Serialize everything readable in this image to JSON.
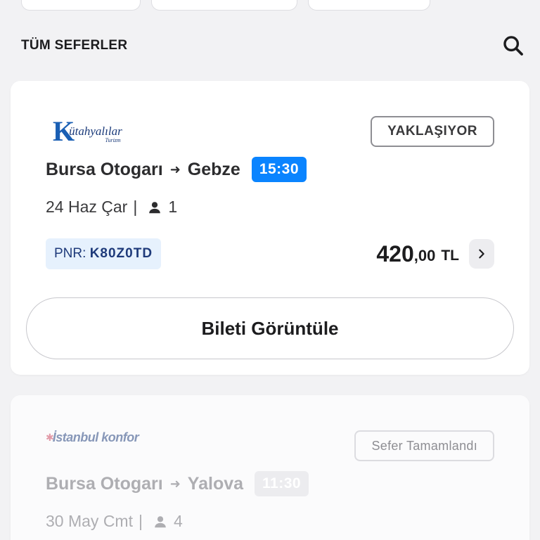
{
  "section": {
    "title": "TÜM SEFERLER"
  },
  "trips": [
    {
      "operator": {
        "logo_main": "K",
        "logo_name": "ütahyalılar",
        "logo_sub": "Turizm"
      },
      "status": "YAKLAŞIYOR",
      "origin": "Bursa Otogarı",
      "destination": "Gebze",
      "time": "15:30",
      "date": "24 Haz Çar",
      "passengers": "1",
      "pnr_label": "PNR:",
      "pnr": "K80Z0TD",
      "price_int": "420",
      "price_dec": ",00",
      "currency": "TL",
      "action": "Bileti Görüntüle"
    },
    {
      "operator": {
        "logo_name": "İstanbul konfor"
      },
      "status": "Sefer Tamamlandı",
      "origin": "Bursa Otogarı",
      "destination": "Yalova",
      "time": "11:30",
      "date": "30 May Cmt",
      "passengers": "4"
    }
  ],
  "colors": {
    "accent": "#0a84ff",
    "pnr_bg": "#e6f1fd",
    "pnr_text": "#1e3a7a"
  },
  "icons": {
    "search": "search-icon",
    "person": "person-icon",
    "arrow": "arrow-right-icon",
    "chevron": "chevron-right-icon"
  }
}
